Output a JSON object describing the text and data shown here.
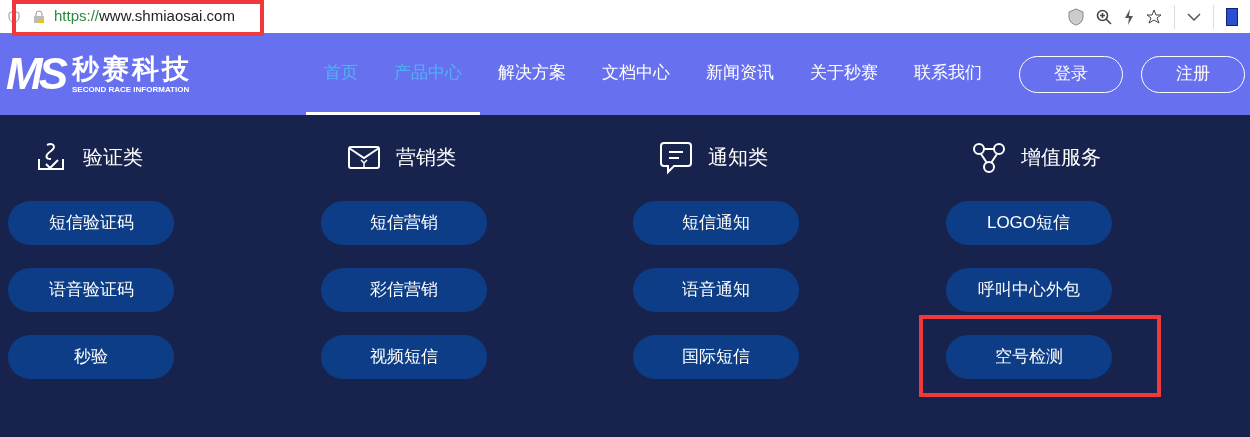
{
  "browser": {
    "url_scheme": "https://",
    "url_host": "www.shmiaosai.com"
  },
  "logo": {
    "mark": "MS",
    "name": "秒赛科技",
    "tagline": "SECOND RACE INFORMATION"
  },
  "nav": [
    {
      "label": "首页",
      "selected": true
    },
    {
      "label": "产品中心",
      "selected": true
    },
    {
      "label": "解决方案",
      "selected": false
    },
    {
      "label": "文档中心",
      "selected": false
    },
    {
      "label": "新闻资讯",
      "selected": false
    },
    {
      "label": "关于秒赛",
      "selected": false
    },
    {
      "label": "联系我们",
      "selected": false
    }
  ],
  "auth_buttons": [
    "登录",
    "注册"
  ],
  "categories": [
    {
      "kind": "verify",
      "title": "验证类",
      "items": [
        {
          "label": "短信验证码",
          "highlighted": false
        },
        {
          "label": "语音验证码",
          "highlighted": false
        },
        {
          "label": "秒验",
          "highlighted": false
        }
      ]
    },
    {
      "kind": "marketing",
      "title": "营销类",
      "items": [
        {
          "label": "短信营销",
          "highlighted": false
        },
        {
          "label": "彩信营销",
          "highlighted": false
        },
        {
          "label": "视频短信",
          "highlighted": false
        }
      ]
    },
    {
      "kind": "notify",
      "title": "通知类",
      "items": [
        {
          "label": "短信通知",
          "highlighted": false
        },
        {
          "label": "语音通知",
          "highlighted": false
        },
        {
          "label": "国际短信",
          "highlighted": false
        }
      ]
    },
    {
      "kind": "value",
      "title": "增值服务",
      "items": [
        {
          "label": "LOGO短信",
          "highlighted": false
        },
        {
          "label": "呼叫中心外包",
          "highlighted": false
        },
        {
          "label": "空号检测",
          "highlighted": true
        }
      ]
    }
  ],
  "url_highlighted": true
}
